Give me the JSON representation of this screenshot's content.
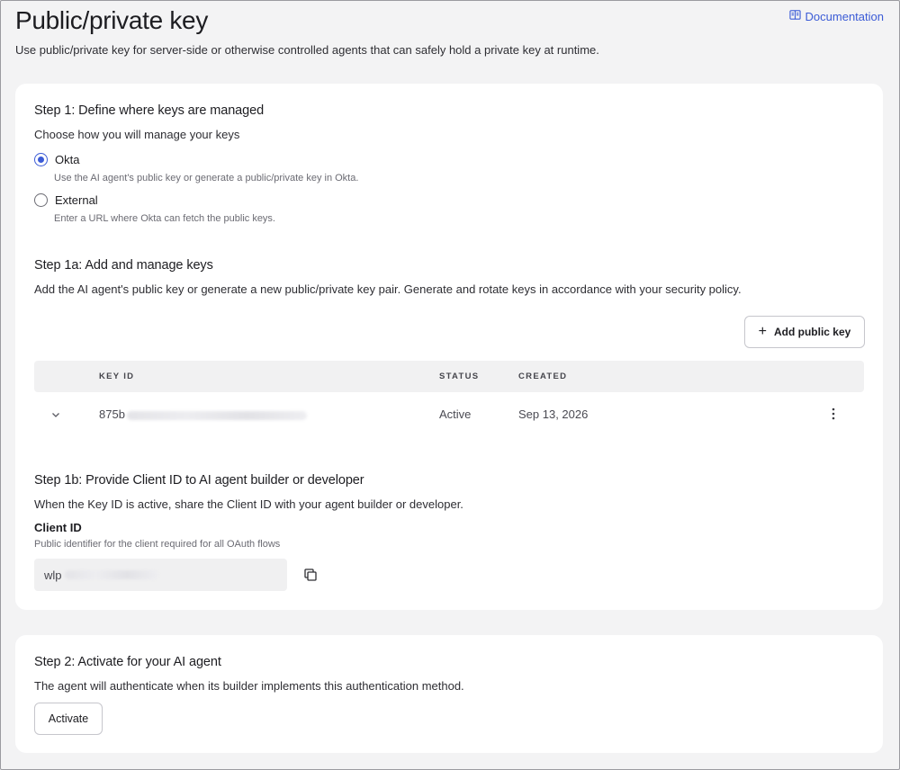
{
  "header": {
    "title": "Public/private key",
    "subtitle": "Use public/private key for server-side or otherwise controlled agents that can safely hold a private key at runtime.",
    "doc_link": "Documentation"
  },
  "step1": {
    "title": "Step 1: Define where keys are managed",
    "desc": "Choose how you will manage your keys",
    "options": [
      {
        "label": "Okta",
        "hint": "Use the AI agent's public key or generate a public/private key in Okta.",
        "checked": true
      },
      {
        "label": "External",
        "hint": "Enter a URL where Okta can fetch the public keys.",
        "checked": false
      }
    ]
  },
  "step1a": {
    "title": "Step 1a: Add and manage keys",
    "desc": "Add the AI agent's public key or generate a new public/private key pair. Generate and rotate keys in accordance with your security policy.",
    "add_button": "Add public key",
    "columns": [
      "KEY ID",
      "STATUS",
      "CREATED"
    ],
    "rows": [
      {
        "key_id": "875b",
        "status": "Active",
        "created": "Sep 13, 2026"
      }
    ]
  },
  "step1b": {
    "title": "Step 1b: Provide Client ID to AI agent builder or developer",
    "desc": "When the Key ID is active, share the Client ID with your agent builder or developer.",
    "field_label": "Client ID",
    "field_hint": "Public identifier for the client required for all OAuth flows",
    "client_id_prefix": "wlp"
  },
  "step2": {
    "title": "Step 2: Activate for your AI agent",
    "desc": "The agent will authenticate when its builder implements this authentication method.",
    "activate_button": "Activate"
  },
  "icons": {
    "doc": "book-icon",
    "add": "plus-icon",
    "expand": "chevron-down-icon",
    "menu": "kebab-menu-icon",
    "copy": "copy-icon"
  },
  "colors": {
    "accent": "#3b5bd6",
    "card": "#ffffff",
    "background": "#f3f3f4"
  }
}
